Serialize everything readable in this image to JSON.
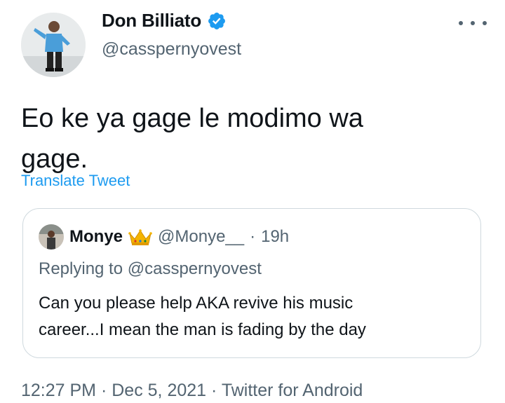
{
  "author": {
    "display_name": "Don Billiato",
    "handle": "@casspernyovest",
    "verified": true,
    "avatar_icon": "profile-photo"
  },
  "tweet": {
    "text_line1": "Eo ke ya gage le modimo wa",
    "text_line2": "gage.",
    "translate_label": "Translate Tweet"
  },
  "quoted": {
    "display_name": "Monye",
    "badge_icon": "crown-icon",
    "handle": "@Monye__",
    "separator": "·",
    "time": "19h",
    "replying_prefix": "Replying to",
    "replying_to": "@casspernyovest",
    "text_line1": "Can you please help AKA revive his music",
    "text_line2": "career...I mean the man is fading by the day"
  },
  "footer": {
    "time": "12:27 PM",
    "date": "Dec 5, 2021",
    "source": "Twitter for Android",
    "separator": "·"
  },
  "colors": {
    "link": "#1d9bf0",
    "secondary_text": "#536471",
    "border": "#cfd9de",
    "text": "#0f1419"
  }
}
